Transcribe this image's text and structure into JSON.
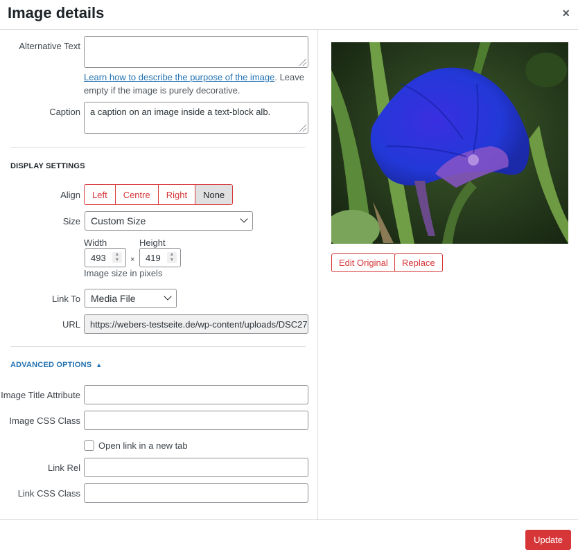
{
  "header": {
    "title": "Image details",
    "close_glyph": "×"
  },
  "form": {
    "alt_text": {
      "label": "Alternative Text",
      "value": ""
    },
    "help": {
      "link_text": "Learn how to describe the purpose of the image",
      "rest": ". Leave empty if the image is purely decorative."
    },
    "caption": {
      "label": "Caption",
      "value": "a caption on an image inside a text-block alb."
    }
  },
  "display_settings": {
    "heading": "DISPLAY SETTINGS",
    "align": {
      "label": "Align",
      "options": [
        "Left",
        "Centre",
        "Right",
        "None"
      ],
      "selected": "None"
    },
    "size": {
      "label": "Size",
      "value": "Custom Size"
    },
    "width": {
      "label": "Width",
      "value": "493"
    },
    "height": {
      "label": "Height",
      "value": "419"
    },
    "times": "×",
    "size_help": "Image size in pixels",
    "link_to": {
      "label": "Link To",
      "value": "Media File"
    },
    "url": {
      "label": "URL",
      "value": "https://webers-testseite.de/wp-content/uploads/DSC27"
    }
  },
  "advanced": {
    "heading": "ADVANCED OPTIONS",
    "title_attr": {
      "label": "Image Title Attribute",
      "value": ""
    },
    "css_class": {
      "label": "Image CSS Class",
      "value": ""
    },
    "new_tab": {
      "label": "Open link in a new tab",
      "checked": false
    },
    "link_rel": {
      "label": "Link Rel",
      "value": ""
    },
    "link_css": {
      "label": "Link CSS Class",
      "value": ""
    }
  },
  "preview": {
    "edit_label": "Edit Original",
    "replace_label": "Replace"
  },
  "footer": {
    "update_label": "Update"
  },
  "colors": {
    "accent": "#d63638",
    "link": "#2271b1"
  }
}
